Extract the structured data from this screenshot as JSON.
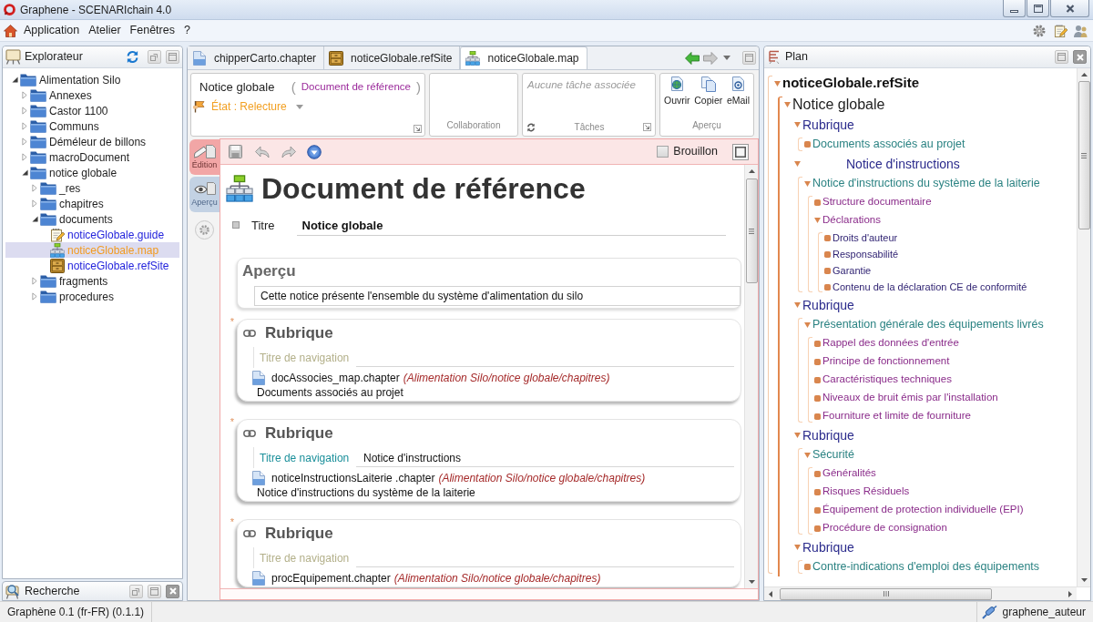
{
  "window": {
    "title": "Graphene - SCENARIchain 4.0"
  },
  "menu": [
    {
      "label": "Application"
    },
    {
      "label": "Atelier"
    },
    {
      "label": "Fenêtres"
    },
    {
      "label": "?"
    }
  ],
  "explorer": {
    "title": "Explorateur",
    "tree": [
      {
        "label": "Alimentation Silo",
        "kind": "folder",
        "expanded": true,
        "selected": false,
        "children": [
          {
            "label": "Annexes",
            "kind": "folder",
            "expanded": false,
            "selected": false
          },
          {
            "label": "Castor 1100",
            "kind": "folder",
            "expanded": false,
            "selected": false
          },
          {
            "label": "Communs",
            "kind": "folder",
            "expanded": false,
            "selected": false
          },
          {
            "label": "Déméleur de billons",
            "kind": "folder",
            "expanded": false,
            "selected": false
          },
          {
            "label": "macroDocument",
            "kind": "folder",
            "expanded": false,
            "selected": false
          },
          {
            "label": "notice globale",
            "kind": "folder",
            "expanded": true,
            "selected": false,
            "children": [
              {
                "label": "_res",
                "kind": "folder",
                "expanded": false,
                "selected": false
              },
              {
                "label": "chapitres",
                "kind": "folder",
                "expanded": false,
                "selected": false
              },
              {
                "label": "documents",
                "kind": "folder",
                "expanded": true,
                "selected": false,
                "children": [
                  {
                    "label": "noticeGlobale.guide",
                    "kind": "guide",
                    "selected": false
                  },
                  {
                    "label": "noticeGlobale.map",
                    "kind": "map",
                    "selected": true
                  },
                  {
                    "label": "noticeGlobale.refSite",
                    "kind": "refsite",
                    "selected": false
                  }
                ]
              },
              {
                "label": "fragments",
                "kind": "folder",
                "expanded": false,
                "selected": false
              },
              {
                "label": "procedures",
                "kind": "folder",
                "expanded": false,
                "selected": false
              }
            ]
          }
        ]
      }
    ]
  },
  "search_panel": {
    "title": "Recherche"
  },
  "tabs": [
    {
      "label": "chipperCarto.chapter",
      "kind": "chapter",
      "selected": false
    },
    {
      "label": "noticeGlobale.refSite",
      "kind": "refsite",
      "selected": false
    },
    {
      "label": "noticeGlobale.map",
      "kind": "map",
      "selected": true
    }
  ],
  "properties": {
    "title": "Notice globale",
    "bracket_open": "(",
    "model": "Document de référence",
    "bracket_close": ")",
    "status": "État : Relecture",
    "collaboration_label": "Collaboration",
    "tasks": {
      "empty_message": "Aucune tâche associée",
      "label": "Tâches"
    },
    "preview": {
      "label": "Aperçu",
      "actions": [
        {
          "label": "Ouvrir",
          "kind": "open"
        },
        {
          "label": "Copier",
          "kind": "copy"
        },
        {
          "label": "eMail",
          "kind": "email"
        }
      ]
    }
  },
  "editor": {
    "side_tabs": [
      {
        "label": "Édition",
        "kind": "edit",
        "selected": true
      },
      {
        "label": "Aperçu",
        "kind": "preview",
        "selected": false
      }
    ],
    "draft": {
      "label": "Brouillon",
      "checked": false
    },
    "heading": "Document de référence",
    "title_field": {
      "label": "Titre",
      "value": "Notice globale"
    },
    "summary": {
      "heading": "Aperçu",
      "value": "Cette notice présente l'ensemble du système d'alimentation du silo"
    },
    "sections": [
      {
        "mark": "*",
        "heading": "Rubrique",
        "nav_label": "Titre de navigation",
        "file": "docAssocies_map.chapter",
        "path": "(Alimentation Silo/notice globale/chapitres)",
        "description": "Documents associés au projet"
      },
      {
        "mark": "*",
        "heading": "Rubrique",
        "nav_label": "Titre de navigation",
        "nav_value": "Notice d'instructions",
        "file": "noticeInstructionsLaiterie .chapter",
        "path": "(Alimentation Silo/notice globale/chapitres)",
        "description": "Notice d'instructions du système de la laiterie"
      },
      {
        "mark": "*",
        "heading": "Rubrique",
        "nav_label": "Titre de navigation",
        "file": "procEquipement.chapter",
        "path": "(Alimentation Silo/notice globale/chapitres)"
      }
    ]
  },
  "plan": {
    "title": "Plan",
    "tree": [
      {
        "label": "noticeGlobale.refSite",
        "expanded": true,
        "children": [
          {
            "label": "Notice globale",
            "expanded": true,
            "children": [
              {
                "label": "Rubrique",
                "kind": "rubrique",
                "expanded": true,
                "children": [
                  {
                    "label": "Documents associés au projet"
                  }
                ]
              },
              {
                "label": "Notice d'instructions",
                "kind": "titled",
                "expanded": true,
                "children": [
                  {
                    "label": "Notice d'instructions du système de la laiterie",
                    "expanded": true,
                    "children": [
                      {
                        "label": "Structure documentaire"
                      },
                      {
                        "label": "Déclarations",
                        "expanded": true,
                        "children": [
                          {
                            "label": "Droits d'auteur"
                          },
                          {
                            "label": "Responsabilité"
                          },
                          {
                            "label": "Garantie"
                          },
                          {
                            "label": "Contenu de la déclaration CE de conformité"
                          }
                        ]
                      }
                    ]
                  }
                ]
              },
              {
                "label": "Rubrique",
                "kind": "rubrique",
                "expanded": true,
                "children": [
                  {
                    "label": "Présentation générale des équipements livrés",
                    "expanded": true,
                    "children": [
                      {
                        "label": "Rappel des données d'entrée"
                      },
                      {
                        "label": "Principe de fonctionnement"
                      },
                      {
                        "label": "Caractéristiques techniques"
                      },
                      {
                        "label": "Niveaux de bruit émis par l'installation"
                      },
                      {
                        "label": "Fourniture et limite de fourniture"
                      }
                    ]
                  }
                ]
              },
              {
                "label": "Rubrique",
                "kind": "rubrique",
                "expanded": true,
                "children": [
                  {
                    "label": "Sécurité",
                    "expanded": true,
                    "children": [
                      {
                        "label": "Généralités"
                      },
                      {
                        "label": "Risques Résiduels"
                      },
                      {
                        "label": "Équipement de protection individuelle (EPI)"
                      },
                      {
                        "label": "Procédure de consignation"
                      }
                    ]
                  }
                ]
              },
              {
                "label": "Rubrique",
                "kind": "rubrique",
                "expanded": true,
                "children": [
                  {
                    "label": "Contre-indications d'emploi des équipements"
                  }
                ]
              }
            ]
          }
        ]
      }
    ]
  },
  "status_bar": {
    "version": "Graphène 0.1 (fr-FR) (0.1.1)",
    "user": "graphene_auteur"
  }
}
